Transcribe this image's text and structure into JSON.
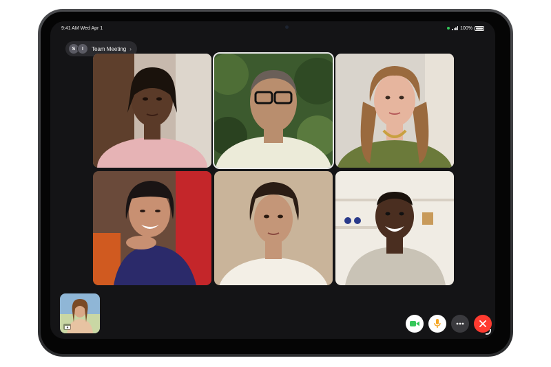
{
  "status": {
    "time": "9:41 AM  Wed Apr 1",
    "battery": "100%"
  },
  "call": {
    "avatar_letters": [
      "S",
      "I"
    ],
    "title": "Team Meeting"
  },
  "participants": [
    {
      "name": "participant-1",
      "bg": "#c7b9ad",
      "shirt": "#e6b3b5",
      "skin": "#5a3a28",
      "hair": "#1a120c"
    },
    {
      "name": "participant-2",
      "bg": "#3c5a2e",
      "shirt": "#ecebd9",
      "skin": "#b98e6e",
      "hair": "#6a5f58"
    },
    {
      "name": "participant-3",
      "bg": "#d9d4cc",
      "shirt": "#6b7a3a",
      "skin": "#e6b59e",
      "hair": "#9a6a3e"
    },
    {
      "name": "participant-4",
      "bg": "#6a4a3a",
      "shirt": "#2b2a6a",
      "skin": "#c89072",
      "hair": "#1a1414"
    },
    {
      "name": "participant-5",
      "bg": "#c9b49a",
      "shirt": "#f3efe6",
      "skin": "#c49678",
      "hair": "#2a1c14"
    },
    {
      "name": "participant-6",
      "bg": "#f0ece4",
      "shirt": "#c9c3b6",
      "skin": "#4a2e20",
      "hair": "#1a120c"
    }
  ],
  "colors": {
    "video": "#34c759",
    "mic": "#f5a623",
    "end": "#ff3b30"
  },
  "controls": [
    "video-camera-icon",
    "microphone-icon",
    "more-icon",
    "end-call-icon"
  ]
}
